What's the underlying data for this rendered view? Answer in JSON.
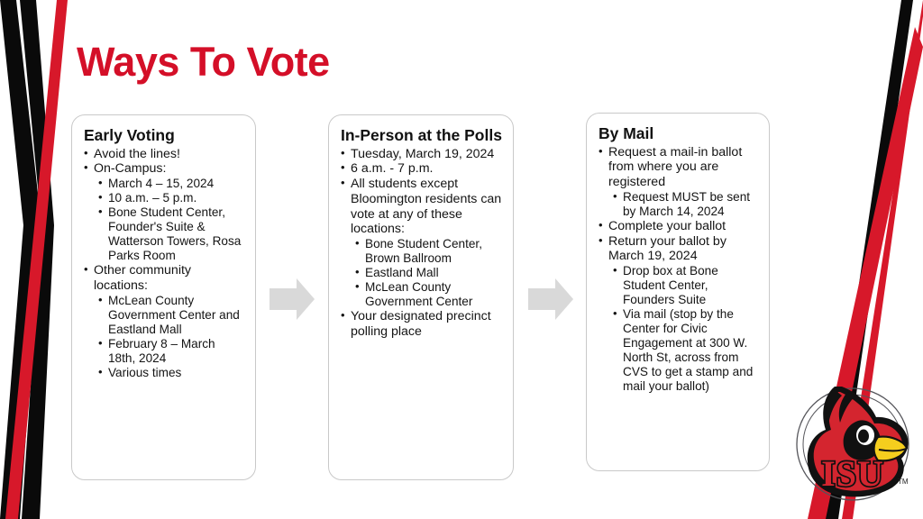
{
  "title": "Ways To Vote",
  "colors": {
    "brand_red": "#D40F28",
    "stripe_red": "#D7182A",
    "stripe_black": "#0A0A0A",
    "card_border": "#c9c9c9",
    "arrow_gray": "#D9D9D9",
    "text": "#141414",
    "logo_gold": "#F5CE1E"
  },
  "arrows": [
    {
      "name": "arrow-early-to-inperson"
    },
    {
      "name": "arrow-inperson-to-bymail"
    }
  ],
  "logo": {
    "name": "isu-redbird-logo",
    "wordmark": "ISU",
    "trademark": "TM"
  },
  "cards": [
    {
      "heading": "Early Voting",
      "items": [
        {
          "level": 1,
          "text": "Avoid the lines!"
        },
        {
          "level": 1,
          "text": "On-Campus:"
        },
        {
          "level": 2,
          "text": "March 4 – 15, 2024"
        },
        {
          "level": 2,
          "text": "10 a.m. – 5 p.m."
        },
        {
          "level": 2,
          "text": "Bone Student Center, Founder's Suite & Watterson Towers, Rosa Parks Room"
        },
        {
          "level": 1,
          "text": "Other community locations:"
        },
        {
          "level": 2,
          "text": "McLean County Government Center and Eastland Mall"
        },
        {
          "level": 2,
          "text": "February 8 – March 18th, 2024"
        },
        {
          "level": 2,
          "text": "Various times"
        }
      ]
    },
    {
      "heading": "In-Person at the Polls",
      "items": [
        {
          "level": 1,
          "text": "Tuesday, March 19, 2024"
        },
        {
          "level": 1,
          "text": "6 a.m. - 7 p.m."
        },
        {
          "level": 1,
          "text": "All students except Bloomington residents can vote at any of these locations:"
        },
        {
          "level": 2,
          "text": "Bone Student Center, Brown Ballroom"
        },
        {
          "level": 2,
          "text": "Eastland Mall"
        },
        {
          "level": 2,
          "text": "McLean County Government Center"
        },
        {
          "level": 1,
          "text": "Your designated precinct polling place"
        }
      ]
    },
    {
      "heading": "By Mail",
      "items": [
        {
          "level": 1,
          "text": "Request a mail-in ballot from where you are registered"
        },
        {
          "level": 2,
          "text": "Request MUST be sent by March 14, 2024"
        },
        {
          "level": 1,
          "text": "Complete your ballot"
        },
        {
          "level": 1,
          "text": "Return your ballot by March 19, 2024"
        },
        {
          "level": 2,
          "text": "Drop box at Bone Student Center, Founders Suite"
        },
        {
          "level": 2,
          "text": "Via mail (stop by the Center for Civic Engagement at 300 W. North St, across from CVS to get a stamp and mail your ballot)"
        }
      ]
    }
  ]
}
